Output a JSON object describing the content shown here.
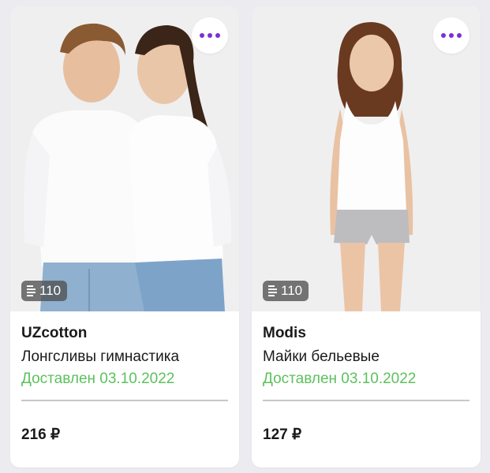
{
  "products": [
    {
      "brand": "UZcotton",
      "title": "Лонгсливы гимнастика",
      "status": "Доставлен 03.10.2022",
      "price": "216 ₽",
      "item_count": "110",
      "more_icon": "more-dots-icon"
    },
    {
      "brand": "Modis",
      "title": "Майки бельевые",
      "status": "Доставлен 03.10.2022",
      "price": "127 ₽",
      "item_count": "110",
      "more_icon": "more-dots-icon"
    }
  ],
  "colors": {
    "status_green": "#5cc15c",
    "accent_purple": "#7b2fd4",
    "background": "#ecebf0"
  }
}
